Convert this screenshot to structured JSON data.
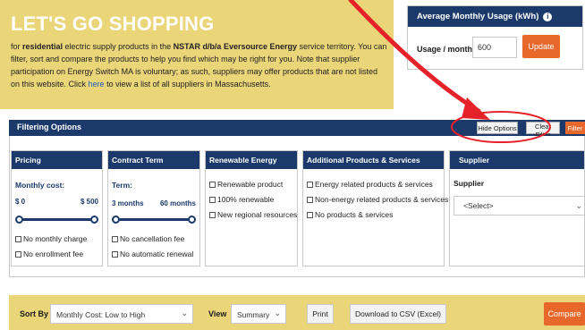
{
  "hero": {
    "title": "LET'S GO SHOPPING",
    "text_1": "for ",
    "text_bold_1": "residential",
    "text_2": " electric supply products in the ",
    "text_bold_2": "NSTAR d/b/a Eversource Energy",
    "text_3": " service territory. You can filter, sort and compare the products to help you find which may be right for you. Note that supplier participation on Energy Switch MA is voluntary; as such, suppliers may offer products that are not listed on this website. Click ",
    "link": "here",
    "text_4": " to view a list of all suppliers in Massachusetts."
  },
  "usage": {
    "title": "Average Monthly Usage (kWh)",
    "info_icon": "info-icon",
    "label": "Usage / month",
    "value": "600",
    "button": "Update"
  },
  "filter_bar": {
    "title": "Filtering Options",
    "hide": "Hide Options",
    "clear": "Clear Filter",
    "filter": "Filter"
  },
  "pricing": {
    "title": "Pricing",
    "sub": "Monthly cost:",
    "min": "$ 0",
    "max": "$ 500",
    "opt_1": "No monthly charge",
    "opt_2": "No enrollment fee"
  },
  "contract": {
    "title": "Contract Term",
    "sub": "Term:",
    "min": "3 months",
    "max": "60 months",
    "opt_1": "No cancellation fee",
    "opt_2": "No automatic renewal"
  },
  "renewable": {
    "title": "Renewable Energy",
    "opt_1": "Renewable product",
    "opt_2": "100% renewable",
    "opt_3": "New regional resources"
  },
  "additional": {
    "title": "Additional Products & Services",
    "opt_1": "Energy related products & services",
    "opt_2": "Non-energy related products & services",
    "opt_3": "No products & services"
  },
  "supplier": {
    "title": "Supplier",
    "sub": "Supplier",
    "select": "<Select>"
  },
  "bottom": {
    "sort_label": "Sort By",
    "sort_value": "Monthly Cost: Low to High",
    "view_label": "View",
    "view_value": "Summary",
    "print": "Print",
    "csv": "Download to CSV (Excel)",
    "compare": "Compare"
  },
  "colors": {
    "navy": "#1b3a6b",
    "gold": "#ead579",
    "orange": "#e8672a",
    "annotation_red": "#e5212a"
  }
}
